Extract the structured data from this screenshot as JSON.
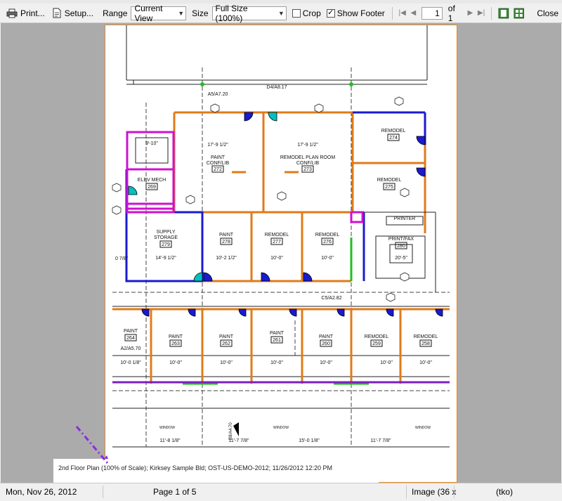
{
  "toolbar": {
    "print_label": "Print...",
    "setup_label": "Setup...",
    "range_label": "Range",
    "range_value": "Current View",
    "size_label": "Size",
    "size_value": "Full Size (100%)",
    "crop_label": "Crop",
    "crop_checked": false,
    "show_footer_label": "Show Footer",
    "show_footer_checked": true,
    "page_value": "1",
    "page_of": "of 1",
    "close_label": "Close"
  },
  "plan": {
    "rooms": [
      {
        "name": "PAINT CONF/LIB",
        "number": "272",
        "dim": "17'-9 1/2\""
      },
      {
        "name": "REMODEL PLAN ROOM CONF/LIB",
        "number": "273",
        "dim": "17'-9 1/2\""
      },
      {
        "name": "REMODEL",
        "number": "274"
      },
      {
        "name": "REMODEL",
        "number": "275"
      },
      {
        "name": "ELEV MECH",
        "number": "269",
        "dim": "9'-10\""
      },
      {
        "name": "SUPPLY STORAGE",
        "number": "279",
        "dim": "14'-9 1/2\""
      },
      {
        "name": "PAINT",
        "number": "278",
        "dim": "10'-2 1/2\""
      },
      {
        "name": "REMODEL",
        "number": "277",
        "dim": "10'-0\""
      },
      {
        "name": "REMODEL",
        "number": "276",
        "dim": "10'-0\""
      },
      {
        "name": "PRINT/FAX",
        "number": "280",
        "dim": "20'-5\""
      },
      {
        "name": "PRINTER"
      },
      {
        "name": "PAINT",
        "number": "264",
        "dim": "10'-0 1/8\""
      },
      {
        "name": "PAINT",
        "number": "263",
        "dim": "10'-0\""
      },
      {
        "name": "PAINT",
        "number": "262",
        "dim": "10'-0\""
      },
      {
        "name": "PAINT",
        "number": "261",
        "dim": "10'-0\""
      },
      {
        "name": "PAINT",
        "number": "260",
        "dim": "10'-0\""
      },
      {
        "name": "REMODEL",
        "number": "259",
        "dim": "10'-0\""
      },
      {
        "name": "REMODEL",
        "number": "258",
        "dim": "10'-0\""
      }
    ],
    "refs": [
      "A5/A7.20",
      "D4/A8.17",
      "C5/A2.82",
      "A2/A5.70",
      "B8/A4.70"
    ],
    "bottom_dims": [
      "11'-8 1/8\"",
      "11'-7 7/8\"",
      "15'-0 1/8\"",
      "11'-7 7/8\""
    ],
    "window_label": "WINDOW",
    "left_dim": "0 7/8\""
  },
  "footer_text": "2nd Floor Plan (100% of Scale); Kirksey Sample Bld; OST-US-DEMO-2012; 11/26/2012 12:20 PM",
  "status": {
    "date": "Mon, Nov 26, 2012",
    "page": "Page 1 of 5",
    "image": "Image (36 x",
    "user": "(tko)"
  },
  "colors": {
    "orange_wall": "#e07b1a",
    "blue_wall": "#1a1ad0",
    "magenta_wall": "#d010d0",
    "green_wall": "#20c020",
    "purple_arrow": "#8a2be2",
    "page_border": "#e08a2c"
  }
}
